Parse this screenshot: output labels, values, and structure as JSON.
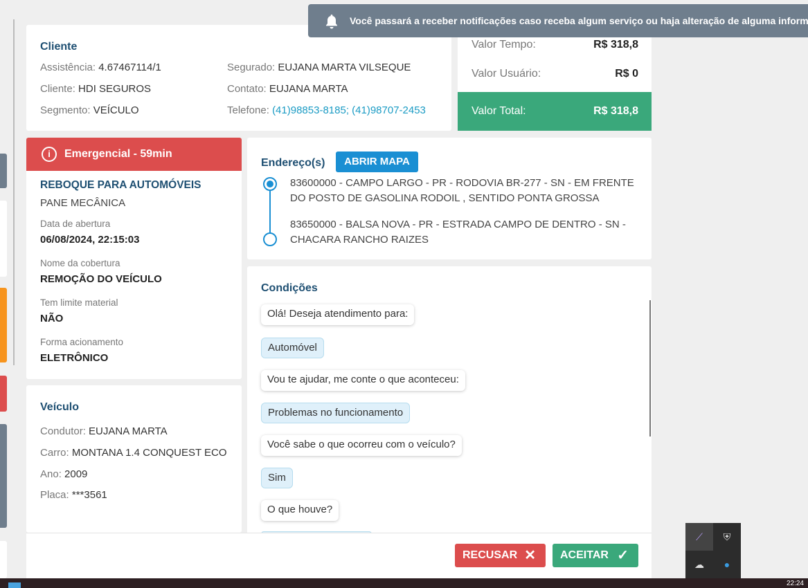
{
  "toast": {
    "message": "Você passará a receber notificações caso receba algum serviço ou haja alteração de alguma informação",
    "icon": "bell-icon"
  },
  "cliente": {
    "heading": "Cliente",
    "assistencia_label": "Assistência:",
    "assistencia_value": "4.67467114/1",
    "cliente_label": "Cliente:",
    "cliente_value": "HDI SEGUROS",
    "segmento_label": "Segmento:",
    "segmento_value": "VEÍCULO",
    "segurado_label": "Segurado:",
    "segurado_value": "EUJANA MARTA VILSEQUE",
    "contato_label": "Contato:",
    "contato_value": "EUJANA MARTA",
    "telefone_label": "Telefone:",
    "telefone_value": "(41)98853-8185; (41)98707-2453"
  },
  "valores": {
    "tempo_label": "Valor Tempo:",
    "tempo_value": "R$ 318,8",
    "usuario_label": "Valor Usuário:",
    "usuario_value": "R$ 0",
    "total_label": "Valor Total:",
    "total_value": "R$ 318,8",
    "total_color": "#3aa87b"
  },
  "servico": {
    "badge": "Emergencial - 59min",
    "badge_color": "#dc4d4d",
    "tipo": "REBOQUE PARA AUTOMÓVEIS",
    "motivo": "PANE MECÂNICA",
    "abertura_label": "Data de abertura",
    "abertura_value": "06/08/2024, 22:15:03",
    "cobertura_label": "Nome da cobertura",
    "cobertura_value": "REMOÇÃO DO VEÍCULO",
    "limite_label": "Tem limite material",
    "limite_value": "NÃO",
    "forma_label": "Forma acionamento",
    "forma_value": "ELETRÔNICO"
  },
  "veiculo": {
    "heading": "Veículo",
    "condutor_label": "Condutor:",
    "condutor_value": "EUJANA MARTA",
    "carro_label": "Carro:",
    "carro_value": "MONTANA 1.4 CONQUEST ECO",
    "ano_label": "Ano:",
    "ano_value": "2009",
    "placa_label": "Placa:",
    "placa_value": "***3561"
  },
  "enderecos": {
    "heading": "Endereço(s)",
    "map_button": "ABRIR MAPA",
    "origem": "83600000 - CAMPO LARGO - PR - RODOVIA BR-277 - SN - EM FRENTE DO POSTO DE GASOLINA RODOIL , SENTIDO PONTA GROSSA",
    "destino": "83650000 - BALSA NOVA - PR - ESTRADA CAMPO DE DENTRO - SN - CHACARA RANCHO RAIZES"
  },
  "condicoes": {
    "heading": "Condições",
    "messages": [
      {
        "from": "bot",
        "text": "Olá! Deseja atendimento para:"
      },
      {
        "from": "user",
        "text": "Automóvel"
      },
      {
        "from": "bot",
        "text": "Vou te ajudar, me conte o que aconteceu:"
      },
      {
        "from": "user",
        "text": "Problemas no funcionamento"
      },
      {
        "from": "bot",
        "text": "Você sabe o que ocorreu com o veículo?"
      },
      {
        "from": "user",
        "text": "Sim"
      },
      {
        "from": "bot",
        "text": "O que houve?"
      }
    ]
  },
  "acoes": {
    "recusar": "RECUSAR",
    "aceitar": "ACEITAR",
    "recusar_color": "#dc4d4d",
    "aceitar_color": "#3aa87b"
  },
  "system": {
    "clock": "22:24"
  }
}
